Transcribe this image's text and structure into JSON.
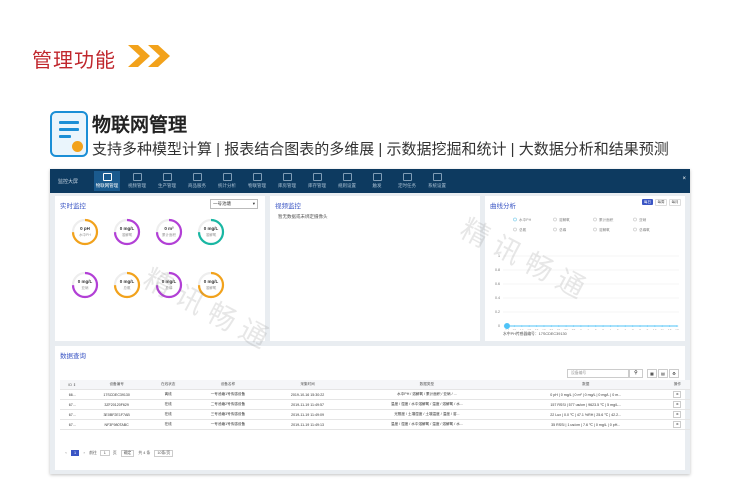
{
  "section": {
    "title": "管理功能"
  },
  "feature": {
    "title": "物联网管理",
    "subtitle": "支持多种模型计算 | 报表结合图表的多维展 | 示数据挖掘和统计 | 大数据分析和结果预测"
  },
  "app": {
    "brand": "监控大屏",
    "nav": [
      "物联网管理",
      "视频管理",
      "生产管理",
      "商品服务",
      "统计分析",
      "物联管理",
      "库房管理",
      "库存管理",
      "规则设置",
      "触发",
      "定时任务",
      "系统设置"
    ],
    "close": "×"
  },
  "realtime": {
    "title": "实时监控",
    "select": "一号池塘",
    "gauges": [
      {
        "value": "0 pH",
        "name": "水中PH"
      },
      {
        "value": "0 mg/L",
        "name": "溶解氧"
      },
      {
        "value": "0 m²",
        "name": "累计面积"
      },
      {
        "value": "0 mg/L",
        "name": "溶解氧"
      },
      {
        "value": "0 mg/L",
        "name": "亚硝"
      },
      {
        "value": "0 mg/L",
        "name": "总氨"
      },
      {
        "value": "0 mg/L",
        "name": "总磷"
      },
      {
        "value": "0 mg/L",
        "name": "溶解氧"
      }
    ]
  },
  "video": {
    "title": "视频监控",
    "empty": "暂无数据或未绑定摄像头"
  },
  "curve": {
    "title": "曲线分析",
    "buttons": [
      "每日",
      "每周",
      "每月"
    ],
    "legend": [
      "水中PH",
      "溶解氧",
      "累计面积",
      "亚硝",
      "总氨",
      "总磷",
      "溶解氧",
      "总磷氧"
    ],
    "footer": "水中PH传感器编号：17SCDEC39130",
    "watermark": "精讯畅通"
  },
  "query": {
    "title": "数据查询",
    "search_placeholder": "设备编号",
    "columns": [
      "ID ⇕",
      "设备编号",
      "在线状态",
      "设备名称",
      "采集时间",
      "数据类型",
      "数据",
      "操作"
    ],
    "rows": [
      [
        "66...",
        "17SCDEC39130",
        "离线",
        "一号池塘1号传感设备",
        "2019-10-16 15:30:22",
        "水中PH / 溶解氧 / 累计面积 / 亚硝 / ...",
        "0 pH | 0 mg/L | 0 m² | 0 mg/L | 0 mg/L | 0 m...",
        "⚙"
      ],
      [
        "67...",
        "3ZF20120F629",
        "在线",
        "二号池塘2号传感设备",
        "2019-11-19 11:49:57",
        "温度 / 湿度 / 水中溶解氧 / 温度 / 溶解氧 / 水...",
        "157 RSSI | 577 us/cm | 9623.5 ℃ | 5 mg/L...",
        "⚙"
      ],
      [
        "67...",
        "3E0BF2E1F7AB",
        "在线",
        "三号池塘3号传感设备",
        "2019-11-19 11:49:09",
        "光照度 / 土壤湿度 / 土壤温度 / 温度 / 溶...",
        "22 Lux | 0.0 ℃ | 47.1 %RH | 25.6 ℃ | 42.2...",
        "⚙"
      ],
      [
        "67...",
        "NF3F980TABC",
        "在线",
        "一号池塘1号传感设备",
        "2019-11-19 11:49:13",
        "温度 / 湿度 / 水中溶解氧 / 温度 / 溶解氧 / 水...",
        "35 RSSI | 1 us/cm | 7.6 ℃ | 0 mg/L | 0 pH...",
        "⚙"
      ]
    ],
    "pager": {
      "prev": "‹",
      "page": "1",
      "goto_label": "前往",
      "page_input": "1",
      "page_unit": "页",
      "confirm": "确定",
      "total": "共 4 条",
      "per_page": "10条/页"
    },
    "watermark": "精讯畅通"
  },
  "chart_data": {
    "type": "line",
    "x": [
      "14",
      "15",
      "16",
      "17",
      "18",
      "19",
      "20",
      "21",
      "22",
      "23",
      "0",
      "1",
      "2",
      "3",
      "4",
      "5",
      "6",
      "7",
      "8",
      "9",
      "10",
      "11",
      "12",
      "13"
    ],
    "series": [
      {
        "name": "水中PH",
        "values": [
          0,
          0,
          0,
          0,
          0,
          0,
          0,
          0,
          0,
          0,
          0,
          0,
          0,
          0,
          0,
          0,
          0,
          0,
          0,
          0,
          0,
          0,
          0,
          0
        ]
      }
    ],
    "yticks": [
      "0",
      "0.2",
      "0.4",
      "0.6",
      "0.8",
      "1"
    ],
    "ylim": [
      0,
      1
    ],
    "grid": true,
    "legend": "top"
  },
  "colors": {
    "accent": "#c0272d",
    "chevron": "#f2a21b",
    "topbar": "#0d3a60",
    "link": "#3a55c4"
  }
}
